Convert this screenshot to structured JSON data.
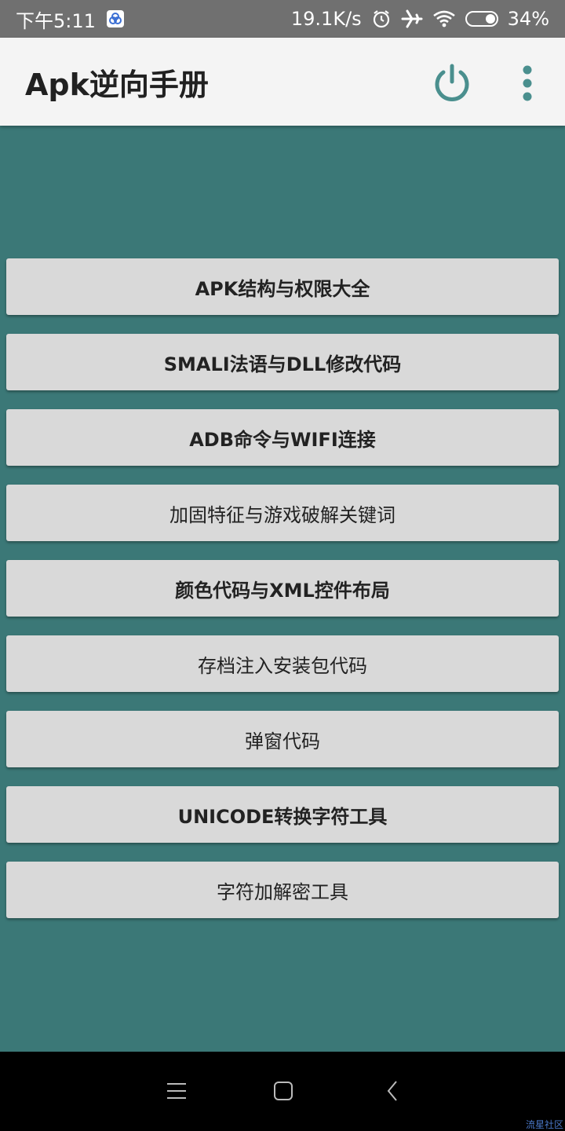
{
  "status_bar": {
    "time": "下午5:11",
    "net_speed": "19.1K/s",
    "battery_percent": "34%",
    "battery_level": 0.34,
    "icons": [
      "app-notification-icon",
      "alarm-icon",
      "airplane-icon",
      "wifi-icon",
      "battery-icon"
    ]
  },
  "toolbar": {
    "title": "Apk逆向手册",
    "accent_color": "#4a8f8e",
    "actions": [
      "power-icon",
      "more-vert-icon"
    ]
  },
  "theme": {
    "background": "#3b7877",
    "button_bg": "#d9d9d9",
    "toolbar_bg": "#f4f4f4"
  },
  "menu": {
    "items": [
      {
        "label": "APK结构与权限大全"
      },
      {
        "label": "SMALI法语与DLL修改代码"
      },
      {
        "label": "ADB命令与WIFI连接"
      },
      {
        "label": "加固特征与游戏破解关键词"
      },
      {
        "label": "颜色代码与XML控件布局"
      },
      {
        "label": "存档注入安装包代码"
      },
      {
        "label": "弹窗代码"
      },
      {
        "label": "UNICODE转换字符工具"
      },
      {
        "label": "字符加解密工具"
      }
    ]
  },
  "nav_bar": {
    "icons": [
      "menu-icon",
      "home-icon",
      "back-icon"
    ]
  },
  "watermark": {
    "text": "流星社区"
  }
}
